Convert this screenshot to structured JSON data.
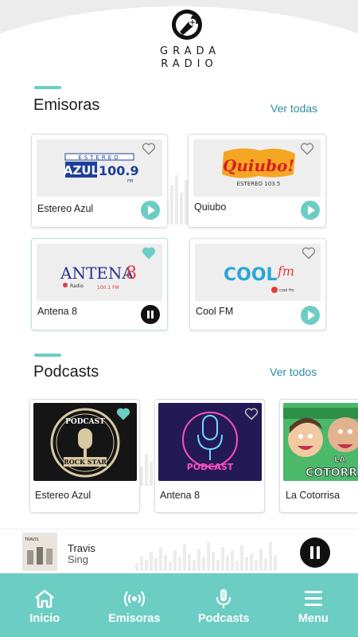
{
  "app": {
    "logo_text_line1": "GRADA",
    "logo_text_line2": "RADIO"
  },
  "colors": {
    "accent": "#6ccdc3",
    "link": "#2d8fa3",
    "dark": "#111111"
  },
  "stations_section": {
    "title": "Emisoras",
    "link": "Ver todas",
    "items": [
      {
        "name": "Estereo Azul",
        "logo_top": "ESTEREO",
        "logo_main": "AZUL",
        "logo_freq": "100.9",
        "logo_band": "FM",
        "favorite": false,
        "state": "play"
      },
      {
        "name": "Quiubo",
        "logo_main": "Quiubo!",
        "logo_sub": "ESTEREO 103.5",
        "favorite": false,
        "state": "play"
      },
      {
        "name": "Antena 8",
        "logo_main": "ANTENA",
        "logo_num": "8",
        "logo_sub1": "Radio",
        "logo_sub2": "100.1 FM",
        "favorite": true,
        "state": "pause"
      },
      {
        "name": "Cool FM",
        "logo_main": "COOL",
        "logo_fm": "fm",
        "logo_sub": "cool fm",
        "favorite": false,
        "state": "play"
      }
    ]
  },
  "podcasts_section": {
    "title": "Podcasts",
    "link": "Ver todos",
    "items": [
      {
        "name": "Estereo Azul",
        "cover_top": "PODCAST",
        "cover_bottom": "ROCK STAR",
        "favorite": true
      },
      {
        "name": "Antena 8",
        "cover_text": "PODCAST",
        "favorite": false
      },
      {
        "name": "La Cotorrisa",
        "cover_text1": "LA",
        "cover_text2": "COTORRIS",
        "favorite": false
      }
    ]
  },
  "player": {
    "artist": "Travis",
    "track": "Sing",
    "art_text": "TRAVIS",
    "state": "pause"
  },
  "bottom_nav": [
    {
      "label": "Inicio",
      "icon": "home-icon"
    },
    {
      "label": "Emisoras",
      "icon": "broadcast-icon"
    },
    {
      "label": "Podcasts",
      "icon": "microphone-icon"
    },
    {
      "label": "Menu",
      "icon": "hamburger-icon"
    }
  ]
}
